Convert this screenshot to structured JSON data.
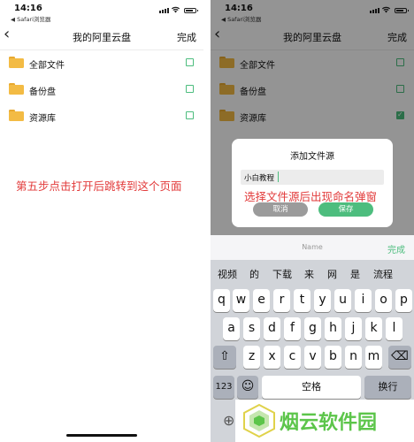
{
  "status": {
    "time": "14:16",
    "back_app": "◀ Safari浏览器"
  },
  "nav": {
    "back_icon": "‹",
    "title": "我的阿里云盘",
    "done": "完成"
  },
  "folders": [
    {
      "label": "全部文件",
      "checked": false
    },
    {
      "label": "备份盘",
      "checked": false
    },
    {
      "label": "资源库",
      "checked": true
    }
  ],
  "left_annotation": "第五步点击打开后跳转到这个页面",
  "right_annotation": "选择文件源后出现命名弹窗",
  "dialog": {
    "title": "添加文件源",
    "input_value": "小白教程",
    "cancel": "取消",
    "save": "保存"
  },
  "keyboard": {
    "toolbar_name": "Name",
    "toolbar_done": "完成",
    "candidates": [
      "视频",
      "的",
      "下载",
      "来",
      "网",
      "是",
      "流程"
    ],
    "row1": [
      "q",
      "w",
      "e",
      "r",
      "t",
      "y",
      "u",
      "i",
      "o",
      "p"
    ],
    "row2": [
      "a",
      "s",
      "d",
      "f",
      "g",
      "h",
      "j",
      "k",
      "l"
    ],
    "row3": [
      "z",
      "x",
      "c",
      "v",
      "b",
      "n",
      "m"
    ],
    "shift_icon": "⇧",
    "delete_icon": "⌫",
    "num_key": "123",
    "emoji_icon": "☺",
    "space": "空格",
    "return": "换行",
    "globe_icon": "⊕"
  },
  "watermark": {
    "text": "烟云软件园"
  },
  "colors": {
    "accent": "#4dbd7e",
    "annotation": "#e23a3a",
    "folder": "#f3bb44"
  }
}
